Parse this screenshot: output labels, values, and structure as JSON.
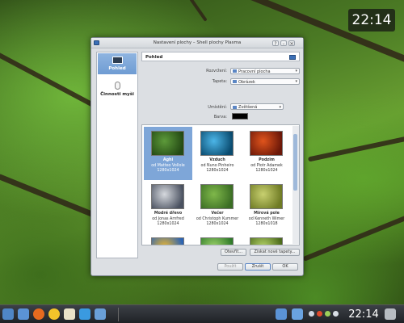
{
  "desktop": {
    "clock": "22:14"
  },
  "window": {
    "title": "Nastavení plochy – Shell plochy Plasma",
    "sidebar": {
      "items": [
        {
          "label": "Pohled"
        },
        {
          "label": "Činnosti myši"
        }
      ]
    },
    "header": "Pohled",
    "layout_label": "Rozvržení:",
    "layout_value": "Pracovní plocha",
    "wallpaper_label": "Tapeta:",
    "wallpaper_value": "Obrázek",
    "positioning_label": "Umístění:",
    "positioning_value": "Zvětšená",
    "color_label": "Barva:",
    "wallpapers": [
      {
        "name": "Aghi",
        "author": "od Matteo Vollole",
        "res": "1280x1024",
        "selected": true,
        "colors": [
          "#5d9a3a",
          "#244a14"
        ]
      },
      {
        "name": "Vzduch",
        "author": "od Nuno Pinheiro",
        "res": "1280x1024",
        "selected": false,
        "colors": [
          "#4cb6e8",
          "#0a4b6f"
        ]
      },
      {
        "name": "Podzim",
        "author": "od Piotr Adamek",
        "res": "1280x1024",
        "selected": false,
        "colors": [
          "#e0541c",
          "#6b1708"
        ]
      },
      {
        "name": "Modré dřevo",
        "author": "od Jonas Arnfred",
        "res": "1280x1024",
        "selected": false,
        "colors": [
          "#d6d9de",
          "#4a5160"
        ]
      },
      {
        "name": "Večer",
        "author": "od Christoph Kummer",
        "res": "1280x1024",
        "selected": false,
        "colors": [
          "#7fb84a",
          "#3b6e24"
        ]
      },
      {
        "name": "Mírová pole",
        "author": "od Kenneth Wimer",
        "res": "1280x1018",
        "selected": false,
        "colors": [
          "#c8d070",
          "#6f7b24"
        ]
      },
      {
        "name": "",
        "author": "",
        "res": "",
        "selected": false,
        "colors": [
          "#f0b82c",
          "#2a63b5"
        ]
      },
      {
        "name": "",
        "author": "",
        "res": "",
        "selected": false,
        "colors": [
          "#9ed36a",
          "#2f7a2a"
        ]
      },
      {
        "name": "",
        "author": "",
        "res": "",
        "selected": false,
        "colors": [
          "#b7d66a",
          "#4c6b1c"
        ]
      }
    ],
    "buttons": {
      "open": "Otevřít...",
      "get_new": "Získat nové tapety...",
      "apply": "Použít",
      "cancel": "Zrušit",
      "ok": "OK"
    }
  },
  "taskbar": {
    "clock": "22:14",
    "launchers": [
      {
        "icon": "kde-menu-icon",
        "color": "#4f86c6"
      },
      {
        "icon": "file-manager-icon",
        "color": "#5b93d6"
      },
      {
        "icon": "firefox-icon",
        "color": "#e66a1f"
      },
      {
        "icon": "chat-icon",
        "color": "#f3c42a"
      },
      {
        "icon": "mail-icon",
        "color": "#e9e2c8"
      },
      {
        "icon": "media-player-icon",
        "color": "#3a9ae0"
      },
      {
        "icon": "system-settings-icon",
        "color": "#6aa0d8"
      }
    ]
  }
}
